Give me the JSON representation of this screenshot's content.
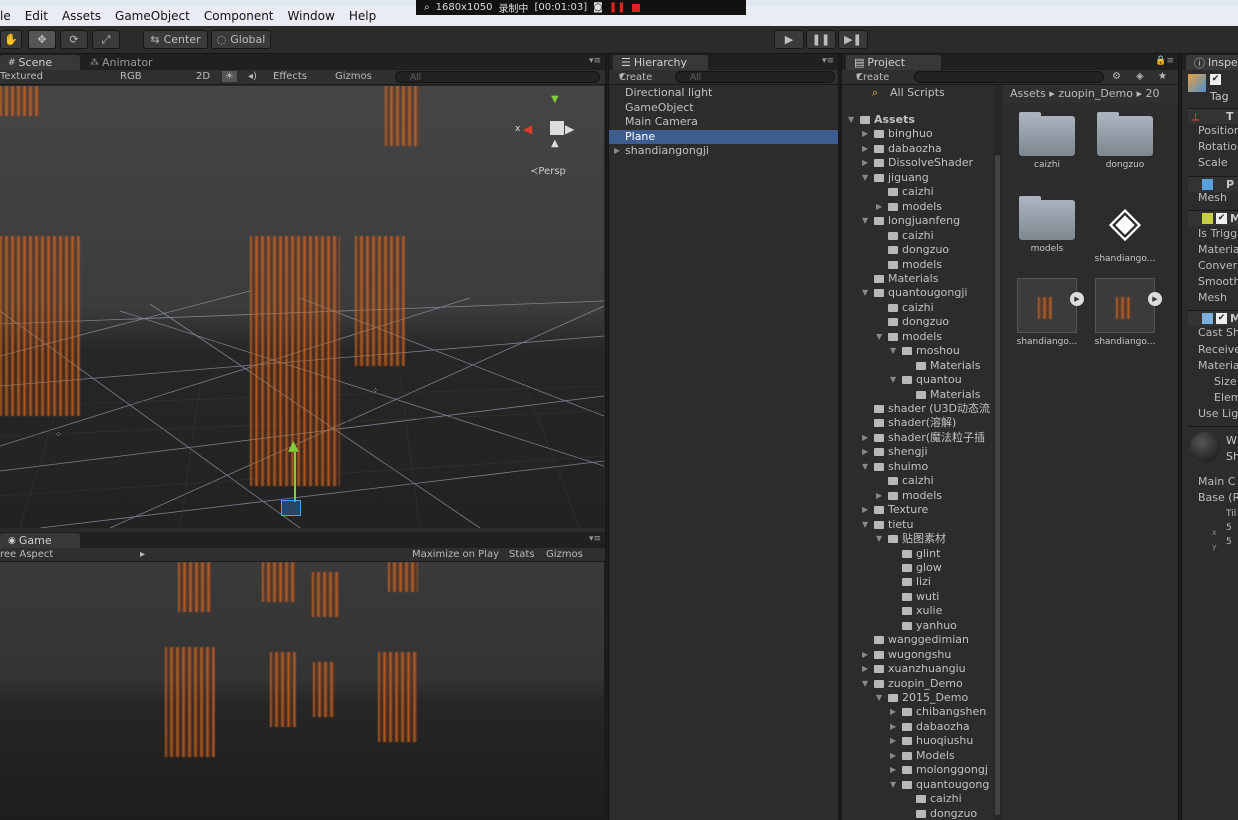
{
  "titlebar": {
    "menu": [
      "File",
      "Edit",
      "Assets",
      "GameObject",
      "Component",
      "Window",
      "Help"
    ],
    "menu_display": [
      "le",
      "Edit",
      "Assets",
      "GameObject",
      "Component",
      "Window",
      "Help"
    ]
  },
  "recorder": {
    "resolution": "1680x1050",
    "status": "录制中",
    "time": "[00:01:03]"
  },
  "toolbar": {
    "pivot": "Center",
    "space": "Global"
  },
  "scene": {
    "tabs": [
      "Scene",
      "Animator"
    ],
    "shading": "Textured",
    "render": "RGB",
    "mode2d": "2D",
    "effects": "Effects",
    "gizmos": "Gizmos",
    "search_placeholder": "All",
    "persp": "Persp"
  },
  "game": {
    "tab": "Game",
    "aspect": "ree Aspect",
    "maximize": "Maximize on Play",
    "stats": "Stats",
    "gizmos": "Gizmos"
  },
  "hierarchy": {
    "tab": "Hierarchy",
    "create": "Create",
    "search_placeholder": "All",
    "items": [
      {
        "label": "Directional light",
        "selected": false,
        "arrow": false
      },
      {
        "label": "GameObject",
        "selected": false,
        "arrow": false
      },
      {
        "label": "Main Camera",
        "selected": false,
        "arrow": false
      },
      {
        "label": "Plane",
        "selected": true,
        "arrow": false
      },
      {
        "label": "shandiangongji",
        "selected": false,
        "arrow": true
      }
    ]
  },
  "project": {
    "tab": "Project",
    "create": "Create",
    "all_scripts": "All Scripts",
    "breadcrumb": [
      "Assets",
      "zuopin_Demo",
      "20"
    ],
    "tree": [
      {
        "label": "Assets",
        "depth": 0,
        "open": true,
        "bold": true
      },
      {
        "label": "binghuo",
        "depth": 1,
        "open": false
      },
      {
        "label": "dabaozha",
        "depth": 1,
        "open": false
      },
      {
        "label": "DissolveShader",
        "depth": 1,
        "open": false
      },
      {
        "label": "jiguang",
        "depth": 1,
        "open": true
      },
      {
        "label": "caizhi",
        "depth": 2,
        "leaf": true
      },
      {
        "label": "models",
        "depth": 2,
        "open": false
      },
      {
        "label": "longjuanfeng",
        "depth": 1,
        "open": true
      },
      {
        "label": "caizhi",
        "depth": 2,
        "leaf": true
      },
      {
        "label": "dongzuo",
        "depth": 2,
        "leaf": true
      },
      {
        "label": "models",
        "depth": 2,
        "leaf": true
      },
      {
        "label": "Materials",
        "depth": 1,
        "leaf": true
      },
      {
        "label": "quantougongji",
        "depth": 1,
        "open": true
      },
      {
        "label": "caizhi",
        "depth": 2,
        "leaf": true
      },
      {
        "label": "dongzuo",
        "depth": 2,
        "leaf": true
      },
      {
        "label": "models",
        "depth": 2,
        "open": true
      },
      {
        "label": "moshou",
        "depth": 3,
        "open": true
      },
      {
        "label": "Materials",
        "depth": 4,
        "leaf": true
      },
      {
        "label": "quantou",
        "depth": 3,
        "open": true
      },
      {
        "label": "Materials",
        "depth": 4,
        "leaf": true
      },
      {
        "label": "shader (U3D动态流",
        "depth": 1,
        "leaf": true
      },
      {
        "label": "shader(溶解)",
        "depth": 1,
        "leaf": true
      },
      {
        "label": "shader(魔法粒子插",
        "depth": 1,
        "open": false
      },
      {
        "label": "shengji",
        "depth": 1,
        "open": false
      },
      {
        "label": "shuimo",
        "depth": 1,
        "open": true
      },
      {
        "label": "caizhi",
        "depth": 2,
        "leaf": true
      },
      {
        "label": "models",
        "depth": 2,
        "open": false
      },
      {
        "label": "Texture",
        "depth": 1,
        "open": false
      },
      {
        "label": "tietu",
        "depth": 1,
        "open": true
      },
      {
        "label": "贴图素材",
        "depth": 2,
        "open": true
      },
      {
        "label": "glint",
        "depth": 3,
        "leaf": true
      },
      {
        "label": "glow",
        "depth": 3,
        "leaf": true
      },
      {
        "label": "lizi",
        "depth": 3,
        "leaf": true
      },
      {
        "label": "wuti",
        "depth": 3,
        "leaf": true
      },
      {
        "label": "xulie",
        "depth": 3,
        "leaf": true
      },
      {
        "label": "yanhuo",
        "depth": 3,
        "leaf": true
      },
      {
        "label": "wanggedimian",
        "depth": 1,
        "leaf": true
      },
      {
        "label": "wugongshu",
        "depth": 1,
        "open": false
      },
      {
        "label": "xuanzhuangiu",
        "depth": 1,
        "open": false
      },
      {
        "label": "zuopin_Demo",
        "depth": 1,
        "open": true
      },
      {
        "label": "2015_Demo",
        "depth": 2,
        "open": true
      },
      {
        "label": "chibangshen",
        "depth": 3,
        "open": false
      },
      {
        "label": "dabaozha",
        "depth": 3,
        "open": false
      },
      {
        "label": "huoqiushu",
        "depth": 3,
        "open": false
      },
      {
        "label": "Models",
        "depth": 3,
        "open": false
      },
      {
        "label": "molonggongj",
        "depth": 3,
        "open": false
      },
      {
        "label": "quantougong",
        "depth": 3,
        "open": true
      },
      {
        "label": "caizhi",
        "depth": 4,
        "leaf": true
      },
      {
        "label": "dongzuo",
        "depth": 4,
        "leaf": true
      }
    ],
    "assets": [
      {
        "label": "caizhi",
        "kind": "folder"
      },
      {
        "label": "dongzuo",
        "kind": "folder"
      },
      {
        "label": "models",
        "kind": "folder"
      },
      {
        "label": "shandiango...",
        "kind": "unity"
      },
      {
        "label": "shandiango...",
        "kind": "prefab"
      },
      {
        "label": "shandiango...",
        "kind": "prefab"
      }
    ]
  },
  "inspector": {
    "tab": "Inspe",
    "tag": "Tag",
    "rows": [
      "Position",
      "Rotatio",
      "Scale",
      "Mesh",
      "Is Trigg",
      "Materia",
      "Conver",
      "Smooth",
      "Mesh",
      "Cast Sh",
      "Receive",
      "Materia",
      "Size",
      "Elem",
      "Use Lig",
      "Main C",
      "Base (R",
      "Til",
      "5",
      "5"
    ],
    "letters": [
      "T",
      "P",
      "M",
      "M"
    ],
    "sh_label": "Sh",
    "w_label": "W",
    "x": "x",
    "y": "y"
  }
}
